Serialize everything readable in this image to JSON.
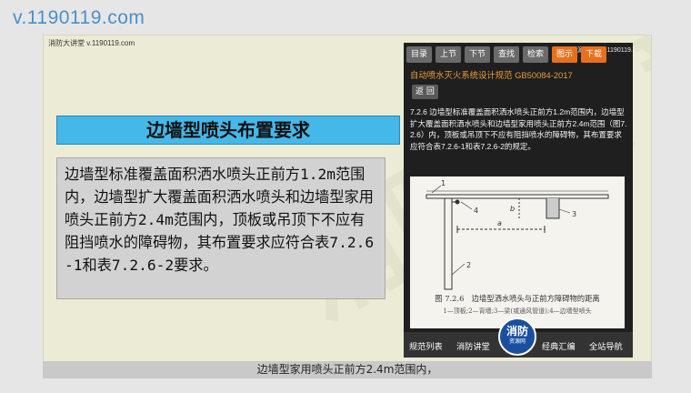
{
  "site_url": "v.1190119.com",
  "slide": {
    "header": "消防大讲堂 v.1190119.com",
    "watermark": "消防 資 龍",
    "title": "边墙型喷头布置要求",
    "content": "边墙型标准覆盖面积洒水喷头正前方1.2m范围内，边墙型扩大覆盖面积洒水喷头和边墙型家用喷头正前方2.4m范围内，顶板或吊顶下不应有阻挡喷水的障碍物，其布置要求应符合表7.2.6-1和表7.2.6-2要求。"
  },
  "panel": {
    "top_label": "消防资源网 www.1190119.com",
    "toolbar": [
      {
        "label": "目录",
        "active": false
      },
      {
        "label": "上节",
        "active": false
      },
      {
        "label": "下节",
        "active": false
      },
      {
        "label": "查找",
        "active": false
      },
      {
        "label": "检索",
        "active": false
      },
      {
        "label": "图示",
        "active": true
      },
      {
        "label": "下载",
        "active": true
      }
    ],
    "doc_title": "自动喷水灭火系统设计规范 GB50084-2017",
    "back_label": "返 回",
    "doc_text": "7.2.6 边墙型标准覆盖面积洒水喷头正前方1.2m范围内，边墙型扩大覆盖面积洒水喷头和边墙型家用喷头正前方2.4m范围（图7.2.6）内，顶板或吊顶下不应有阻挡喷水的障碍物，其布置要求应符合表7.2.6-1和表7.2.6-2的规定。",
    "figure": {
      "labels": [
        "1",
        "2",
        "3",
        "4",
        "a",
        "b"
      ],
      "caption": "图 7.2.6　边墙型洒水喷头与正前方障碍物的距离",
      "legend": "1—顶板;2—背墙;3—梁(或通风管道);4—边墙型喷头"
    },
    "bottom_nav": [
      "规范列表",
      "消防讲堂",
      "经典汇编",
      "全站导航"
    ],
    "logo": {
      "main": "消防",
      "sub": "资源网"
    }
  },
  "subtitle": "边墙型家用喷头正前方2.4m范围内，",
  "colors": {
    "accent": "#e8701c",
    "title_bg": "#45b8ea",
    "url": "#4a90c8",
    "logo": "#1a4fa0"
  }
}
